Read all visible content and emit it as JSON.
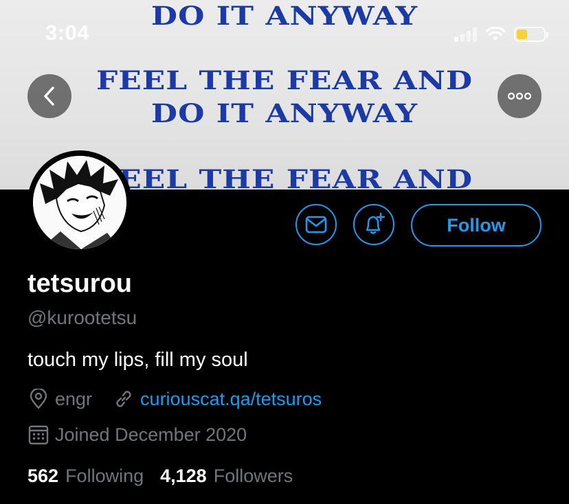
{
  "status_bar": {
    "time": "3:04",
    "battery_level": 0.35,
    "battery_color": "#f5d13b"
  },
  "banner": {
    "lines": [
      "DO IT ANYWAY",
      "FEEL THE FEAR AND",
      "DO IT ANYWAY",
      "FEEL THE FEAR AND"
    ],
    "text_color": "#1c3aa6"
  },
  "nav": {
    "back_icon": "chevron-left-icon",
    "more_icon": "ellipsis-icon"
  },
  "actions": {
    "follow_label": "Follow",
    "accent_color": "#1d9bf0"
  },
  "profile": {
    "display_name": "tetsurou",
    "handle": "@kurootetsu",
    "bio": "touch my lips, fill my soul",
    "location": "engr",
    "website": "curiouscat.qa/tetsuros",
    "joined": "Joined December 2020",
    "following_count": "562",
    "following_label": "Following",
    "followers_count": "4,128",
    "followers_label": "Followers"
  }
}
